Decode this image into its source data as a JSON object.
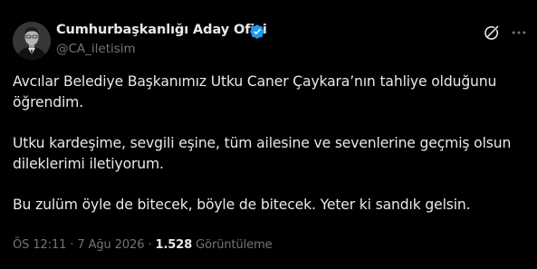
{
  "author": {
    "name": "Cumhurbaşkanlığı Aday Ofisi",
    "handle": "@CA_iletisim",
    "verified_color": "#1d9bf0"
  },
  "header_actions": {
    "grok_icon": "grok-icon",
    "more_icon": "more-icon"
  },
  "tweet": {
    "paragraphs": [
      {
        "lines": [
          "Avcılar Belediye Başkanımız Utku Caner Çaykara’nın tahliye olduğunu",
          "öğrendim."
        ]
      },
      {
        "lines": [
          "Utku kardeşime, sevgili eşine, tüm ailesine ve sevenlerine geçmiş olsun",
          "dileklerimi iletiyorum."
        ]
      },
      {
        "lines": [
          "Bu zulüm öyle de bitecek, böyle de bitecek. Yeter ki sandık gelsin."
        ]
      }
    ]
  },
  "meta": {
    "time": "ÖS 12:11",
    "separator1": " · ",
    "date": "7 Ağu 2026",
    "separator2": " · ",
    "views_count": "1.528",
    "views_label": " Görüntüleme"
  },
  "colors": {
    "background": "#000000",
    "primary_text": "#e7e9ea",
    "secondary_text": "#71767b",
    "accent": "#1d9bf0"
  }
}
